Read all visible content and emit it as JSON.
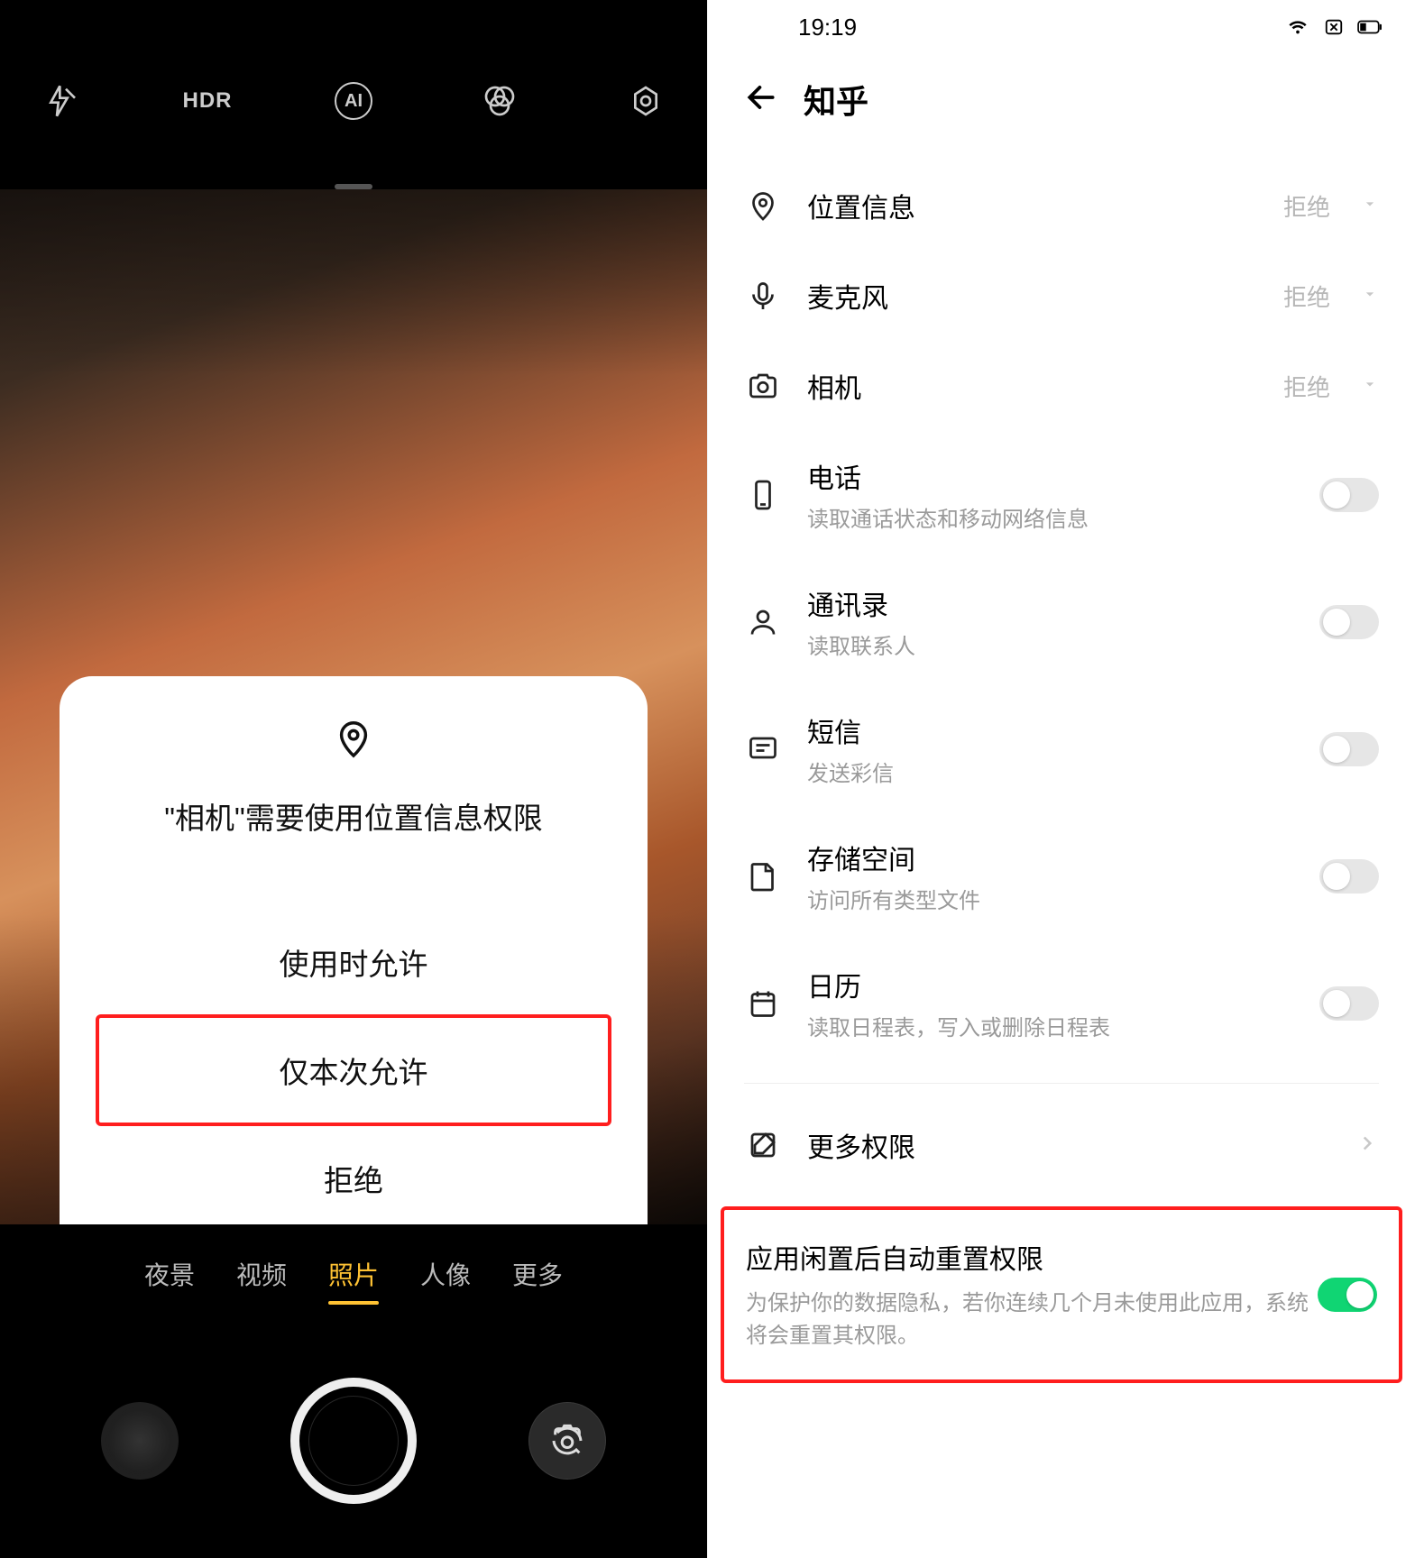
{
  "left": {
    "topbar": {
      "hdr": "HDR",
      "ai": "AI"
    },
    "modes": {
      "night": "夜景",
      "video": "视频",
      "photo": "照片",
      "portrait": "人像",
      "more": "更多"
    },
    "dialog": {
      "title": "\"相机\"需要使用位置信息权限",
      "opt1": "使用时允许",
      "opt2": "仅本次允许",
      "opt3": "拒绝"
    }
  },
  "right": {
    "status": {
      "time": "19:19"
    },
    "header": {
      "title": "知乎"
    },
    "perm": {
      "location": {
        "label": "位置信息",
        "status": "拒绝"
      },
      "mic": {
        "label": "麦克风",
        "status": "拒绝"
      },
      "camera": {
        "label": "相机",
        "status": "拒绝"
      },
      "phone": {
        "label": "电话",
        "sub": "读取通话状态和移动网络信息"
      },
      "contacts": {
        "label": "通讯录",
        "sub": "读取联系人"
      },
      "sms": {
        "label": "短信",
        "sub": "发送彩信"
      },
      "storage": {
        "label": "存储空间",
        "sub": "访问所有类型文件"
      },
      "calendar": {
        "label": "日历",
        "sub": "读取日程表，写入或删除日程表"
      }
    },
    "more": {
      "label": "更多权限"
    },
    "auto": {
      "title": "应用闲置后自动重置权限",
      "sub": "为保护你的数据隐私，若你连续几个月未使用此应用，系统将会重置其权限。"
    }
  }
}
